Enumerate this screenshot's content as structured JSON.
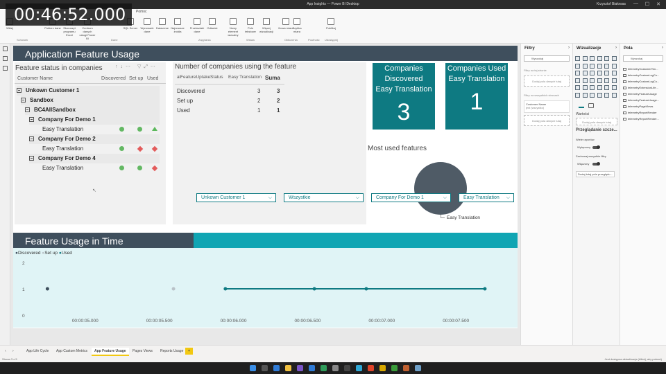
{
  "window": {
    "title": "App Insights — Power BI Desktop",
    "user": "Krzysztof Białowas"
  },
  "timer": "00:46:52.000",
  "ribbon": {
    "tabs": [
      "Plik",
      "Narzędzia główne",
      "Wstaw",
      "Modelowanie",
      "Widok",
      "Optymalizuj",
      "Pomoc"
    ],
    "buttons": [
      "Wklej",
      "Pobierz dane",
      "Skoroszyt programu Excel",
      "Centrum danych usługi Power BI",
      "SQL Server",
      "Wprowadź dane",
      "Dataverse",
      "Najnowsze źródła",
      "Przekształć dane",
      "Odśwież",
      "Nowy element wizualny",
      "Pole tekstowe",
      "Więcej wizualizacji",
      "Nowa miara",
      "Szybka miara",
      "Publikuj"
    ],
    "groups": [
      "Schowek",
      "Dane",
      "Zapytania",
      "Wstaw",
      "Obliczenia",
      "Poufność",
      "Udostępnij"
    ]
  },
  "report": {
    "header_title": "Application Feature Usage",
    "tree_title": "Feature status in companies",
    "tree_cols": [
      "Customer Name",
      "Discovered",
      "Set up",
      "Used"
    ],
    "tree": [
      {
        "label": "Unkown Customer 1",
        "bold": true
      },
      {
        "label": "Sandbox",
        "bold": true
      },
      {
        "label": "BC4AllSandbox",
        "bold": true
      },
      {
        "label": "Company For Demo 1",
        "bold": true
      },
      {
        "label": "Easy Translation",
        "bold": false,
        "status": [
          "circle",
          "circle",
          "triangle"
        ]
      },
      {
        "label": "Company For Demo 2",
        "bold": true
      },
      {
        "label": "Easy Translation",
        "bold": false,
        "status": [
          "circle",
          "diamond",
          "diamond"
        ]
      },
      {
        "label": "Company For Demo 4",
        "bold": true
      },
      {
        "label": "Easy Translation",
        "bold": false,
        "status": [
          "circle",
          "circle",
          "diamond"
        ]
      }
    ],
    "matrix_title": "Number of companies using the feature",
    "matrix_cols": [
      "alFeatureUptakeStatus",
      "Easy Translation",
      "Suma"
    ],
    "matrix_rows": [
      {
        "label": "Discovered",
        "value": "3",
        "total": "3"
      },
      {
        "label": "Set up",
        "value": "2",
        "total": "2"
      },
      {
        "label": "Used",
        "value": "1",
        "total": "1"
      }
    ],
    "card1_title": "Companies Discovered Easy Translation",
    "card1_value": "3",
    "card2_title": "Companies Used Easy Translation",
    "card2_value": "1",
    "pie_title": "Most used features",
    "pie_label": "Easy Translation",
    "time_title": "Feature Usage in Time",
    "slicers": [
      "Unkown Customer 1",
      "Wszystkie",
      "Company For Demo 1",
      "Easy Translation"
    ],
    "legend": [
      {
        "name": "Discovered",
        "color": "#3f4f5d"
      },
      {
        "name": "Set up",
        "color": "#b9c2c8"
      },
      {
        "name": "Used",
        "color": "#0e7a82"
      }
    ]
  },
  "chart_data": {
    "type": "line",
    "title": "Feature Usage in Time",
    "x_ticks": [
      "00:00:05.000",
      "00:00:05.500",
      "00:00:06.000",
      "00:00:06.500",
      "00:00:07.000",
      "00:00:07.500"
    ],
    "ylim": [
      0,
      2
    ],
    "y_ticks": [
      "0",
      "1",
      "2"
    ],
    "series": [
      {
        "name": "Discovered",
        "color": "#3f4f5d",
        "points": [
          [
            4.75,
            1
          ]
        ]
      },
      {
        "name": "Set up",
        "color": "#b9c2c8",
        "points": [
          [
            5.6,
            1
          ]
        ]
      },
      {
        "name": "Used",
        "color": "#0e7a82",
        "points": [
          [
            5.95,
            1
          ],
          [
            6.55,
            1
          ],
          [
            6.9,
            1
          ],
          [
            7.7,
            1
          ]
        ]
      }
    ],
    "xlim": [
      4.65,
      7.85
    ],
    "legend_position": "top-left"
  },
  "page_tabs": [
    "App Life Cycle",
    "App Custom Metrics",
    "App Feature Usage",
    "Pages Views",
    "Reports Usage"
  ],
  "active_tab": "App Feature Usage",
  "add_tab": "+",
  "status_left": "Strona 3 z 5",
  "status_right": "Jest dostępna aktualizacja (kliknij, aby pobrać)",
  "filters": {
    "title": "Filtry",
    "search": "Wyszukaj",
    "on_page": "Filtry na tej stronie",
    "add_here": "Dodaj pola danych tutaj",
    "on_all": "Filtry na wszystkich stronach",
    "customer": "Customer Name",
    "customer_val": "jest (wszystko)",
    "add_here2": "Dodaj pola danych tutaj"
  },
  "viz": {
    "title": "Wizualizacje",
    "values": "Wartości",
    "add_fields": "Dodaj pola danych tutaj",
    "drill": "Przeglądanie szcze...",
    "cross": "Wiele raportów",
    "off1": "Wyłączony",
    "keep": "Zachowaj wszystkie filtry",
    "off2": "Włączony",
    "add_drill": "Dodaj tutaj pola przeglądu..."
  },
  "fields": {
    "title": "Pola",
    "search": "Wyszukaj",
    "items": [
      "telemetryCustomerTen...",
      "telemetryCustomLogCo...",
      "telemetryCustomLogCo...",
      "telemetryExtensionLife...",
      "telemetryFeatureUsage",
      "telemetryFeatureUsage...",
      "telemetryPageViews",
      "telemetryReportRender",
      "telemetryReportRender..."
    ]
  }
}
